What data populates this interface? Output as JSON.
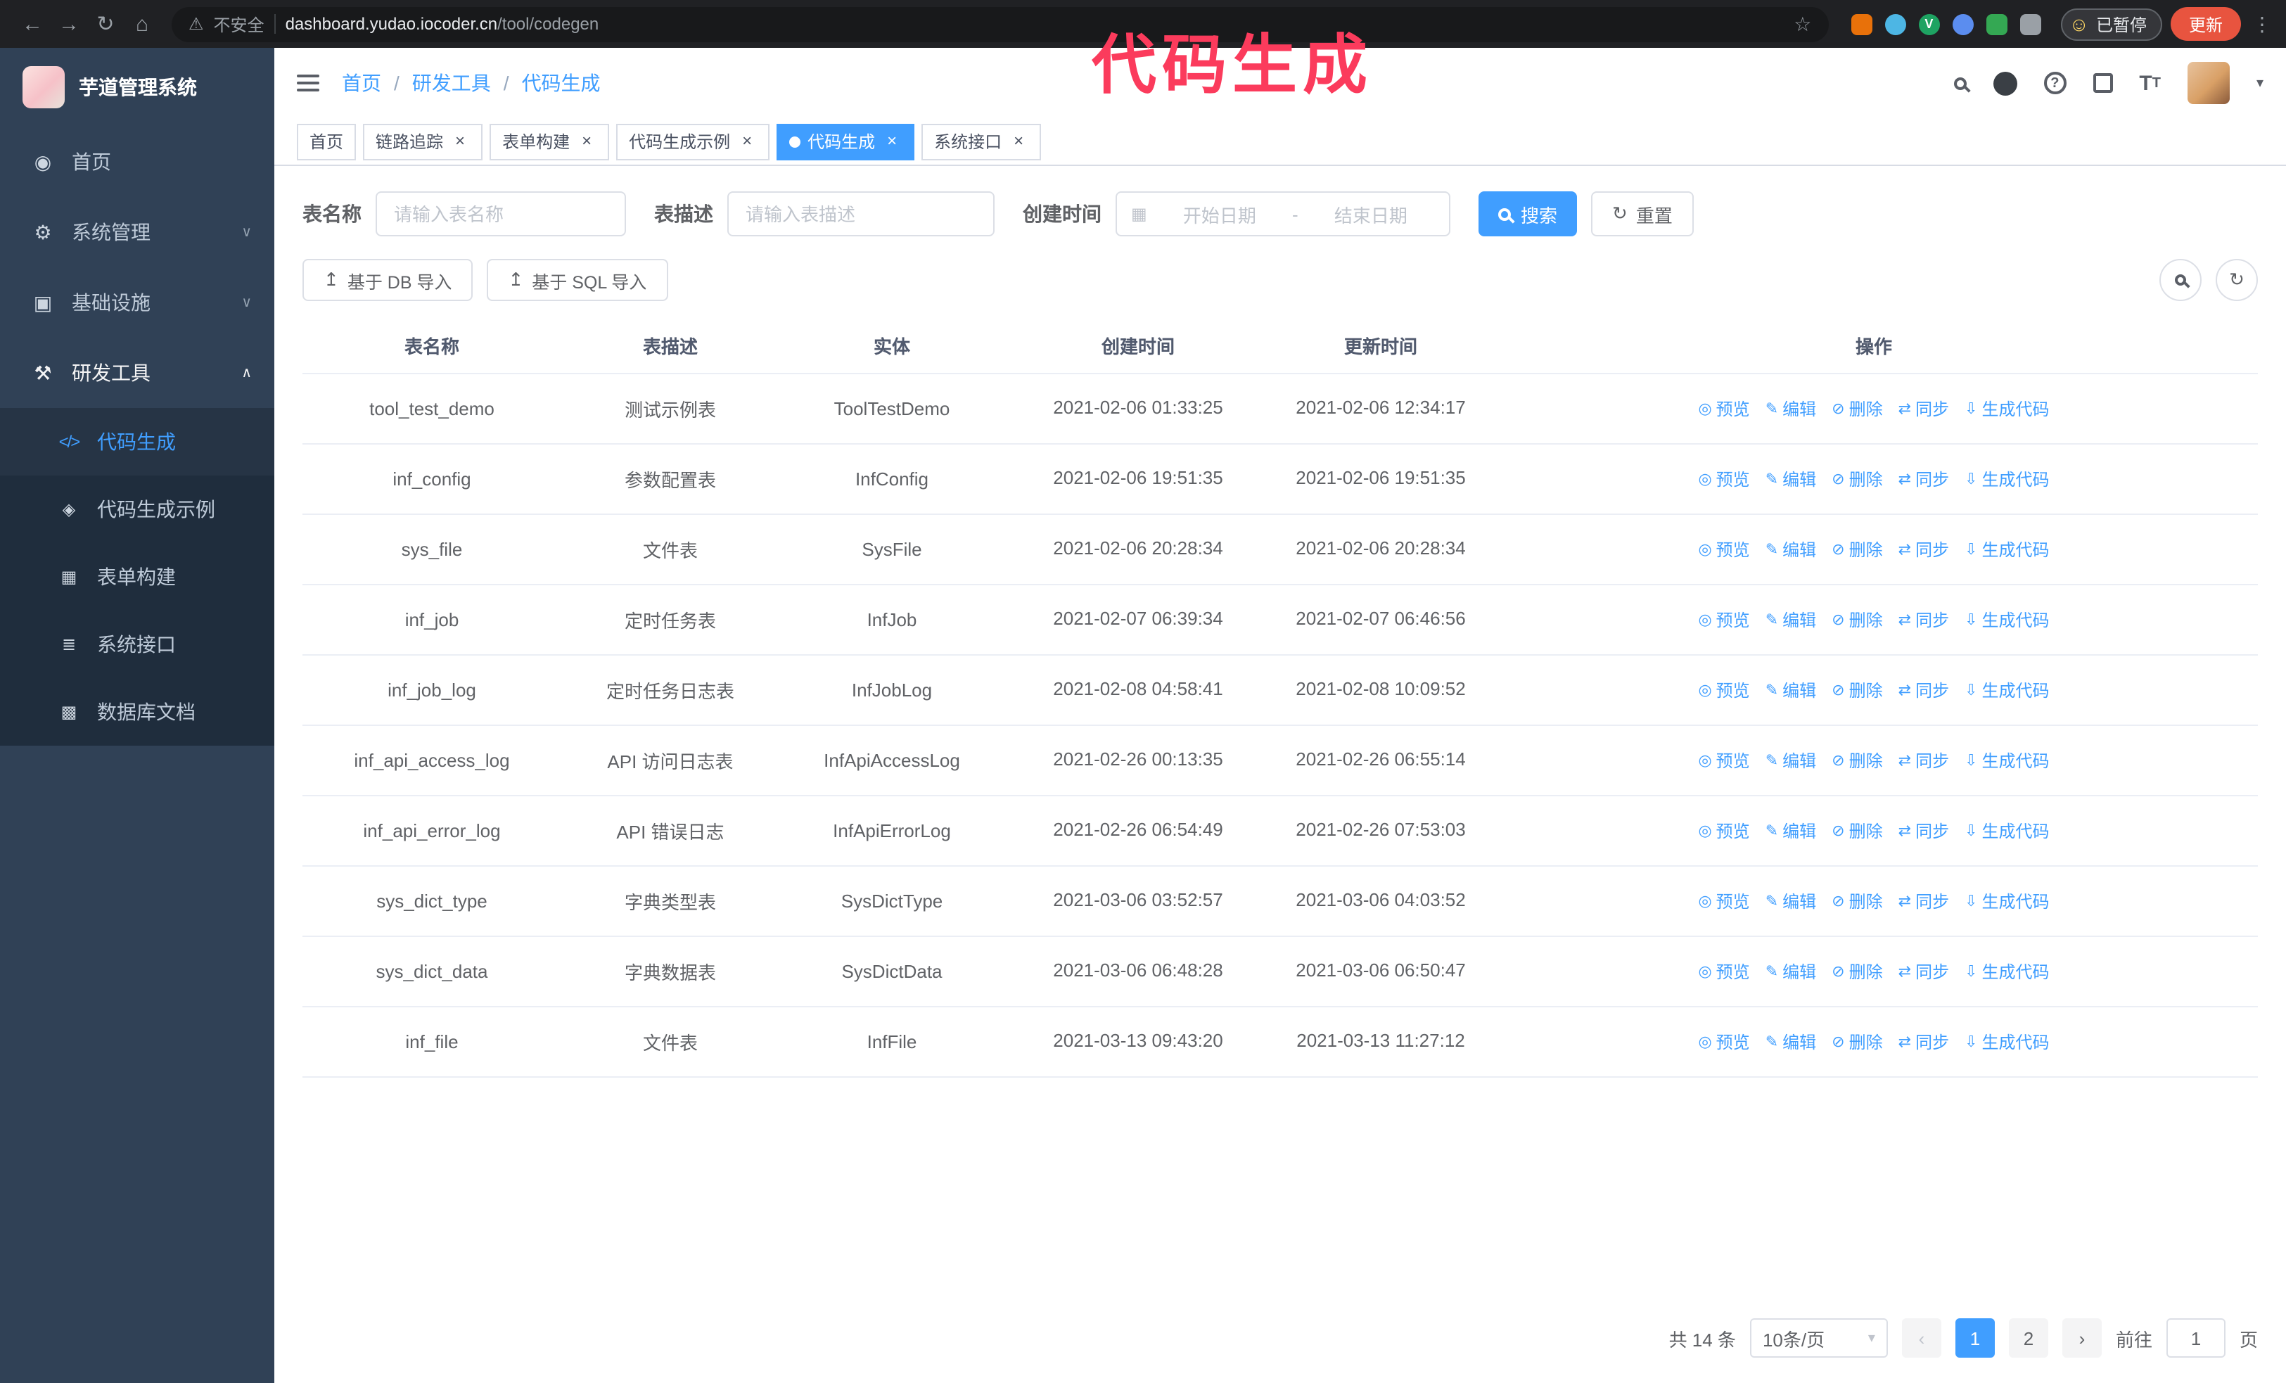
{
  "annotation": {
    "text": "代码生成"
  },
  "colors": {
    "accent": "#409eff",
    "sidebar": "#304156",
    "submenu": "#1f2d3d",
    "annotation": "#fb3b5c"
  },
  "browser": {
    "security_label": "不安全",
    "url_domain": "dashboard.yudao.iocoder.cn",
    "url_path": "/tool/codegen",
    "extension_badge": "V",
    "paused_badge": "已暂停",
    "update_button": "更新"
  },
  "sidebar": {
    "logo_title": "芋道管理系统",
    "items": [
      {
        "label": "首页",
        "icon": "dashboard-icon"
      },
      {
        "label": "系统管理",
        "icon": "gear-icon"
      },
      {
        "label": "基础设施",
        "icon": "infrastructure-icon"
      },
      {
        "label": "研发工具",
        "icon": "tools-icon"
      }
    ],
    "subitems": [
      {
        "label": "代码生成",
        "icon": "code-icon",
        "active": true
      },
      {
        "label": "代码生成示例",
        "icon": "example-icon"
      },
      {
        "label": "表单构建",
        "icon": "form-icon"
      },
      {
        "label": "系统接口",
        "icon": "api-icon"
      },
      {
        "label": "数据库文档",
        "icon": "database-doc-icon"
      }
    ]
  },
  "header": {
    "breadcrumb": [
      "首页",
      "研发工具",
      "代码生成"
    ],
    "breadcrumb_separator": "/"
  },
  "tabs": [
    {
      "label": "首页",
      "closable": false
    },
    {
      "label": "链路追踪",
      "closable": true
    },
    {
      "label": "表单构建",
      "closable": true
    },
    {
      "label": "代码生成示例",
      "closable": true
    },
    {
      "label": "代码生成",
      "closable": true,
      "active": true
    },
    {
      "label": "系统接口",
      "closable": true
    }
  ],
  "filters": {
    "table_name_label": "表名称",
    "table_name_placeholder": "请输入表名称",
    "table_desc_label": "表描述",
    "table_desc_placeholder": "请输入表描述",
    "create_time_label": "创建时间",
    "date_start_placeholder": "开始日期",
    "date_separator": "-",
    "date_end_placeholder": "结束日期",
    "search_button": "搜索",
    "reset_button": "重置"
  },
  "toolbar": {
    "import_db": "基于 DB 导入",
    "import_sql": "基于 SQL 导入"
  },
  "table": {
    "columns": [
      "表名称",
      "表描述",
      "实体",
      "创建时间",
      "更新时间",
      "操作"
    ],
    "actions": [
      "预览",
      "编辑",
      "删除",
      "同步",
      "生成代码"
    ],
    "rows": [
      {
        "name": "tool_test_demo",
        "desc": "测试示例表",
        "entity": "ToolTestDemo",
        "created": "2021-02-06 01:33:25",
        "updated": "2021-02-06 12:34:17"
      },
      {
        "name": "inf_config",
        "desc": "参数配置表",
        "entity": "InfConfig",
        "created": "2021-02-06 19:51:35",
        "updated": "2021-02-06 19:51:35"
      },
      {
        "name": "sys_file",
        "desc": "文件表",
        "entity": "SysFile",
        "created": "2021-02-06 20:28:34",
        "updated": "2021-02-06 20:28:34"
      },
      {
        "name": "inf_job",
        "desc": "定时任务表",
        "entity": "InfJob",
        "created": "2021-02-07 06:39:34",
        "updated": "2021-02-07 06:46:56"
      },
      {
        "name": "inf_job_log",
        "desc": "定时任务日志表",
        "entity": "InfJobLog",
        "created": "2021-02-08 04:58:41",
        "updated": "2021-02-08 10:09:52"
      },
      {
        "name": "inf_api_access_log",
        "desc": "API 访问日志表",
        "entity": "InfApiAccessLog",
        "created": "2021-02-26 00:13:35",
        "updated": "2021-02-26 06:55:14"
      },
      {
        "name": "inf_api_error_log",
        "desc": "API 错误日志",
        "entity": "InfApiErrorLog",
        "created": "2021-02-26 06:54:49",
        "updated": "2021-02-26 07:53:03"
      },
      {
        "name": "sys_dict_type",
        "desc": "字典类型表",
        "entity": "SysDictType",
        "created": "2021-03-06 03:52:57",
        "updated": "2021-03-06 04:03:52"
      },
      {
        "name": "sys_dict_data",
        "desc": "字典数据表",
        "entity": "SysDictData",
        "created": "2021-03-06 06:48:28",
        "updated": "2021-03-06 06:50:47"
      },
      {
        "name": "inf_file",
        "desc": "文件表",
        "entity": "InfFile",
        "created": "2021-03-13 09:43:20",
        "updated": "2021-03-13 11:27:12"
      }
    ]
  },
  "pagination": {
    "total": "共 14 条",
    "page_size": "10条/页",
    "pages": [
      "1",
      "2"
    ],
    "goto_label": "前往",
    "goto_value": "1",
    "goto_suffix": "页"
  },
  "icons": {
    "back": "←",
    "forward": "→",
    "reload": "↻",
    "home": "⌂",
    "warning": "⚠",
    "star": "☆",
    "dots": "⋮",
    "smiley": "☺",
    "dashboard": "◉",
    "gear": "⚙",
    "infra": "▣",
    "tools": "⚒",
    "chevron_down": "∨",
    "chevron_up": "∧",
    "code": "</>",
    "example": "◈",
    "form": "▦",
    "api": "≣",
    "db_doc": "▩",
    "question": "?",
    "caret_down": "▾",
    "font_big": "T",
    "font_small": "T",
    "calendar": "▦",
    "refresh": "↻",
    "upload": "↥",
    "eye": "◎",
    "edit": "✎",
    "delete": "⊘",
    "sync": "⇄",
    "download": "⇩",
    "prev": "‹",
    "next": "›",
    "close": "×"
  }
}
